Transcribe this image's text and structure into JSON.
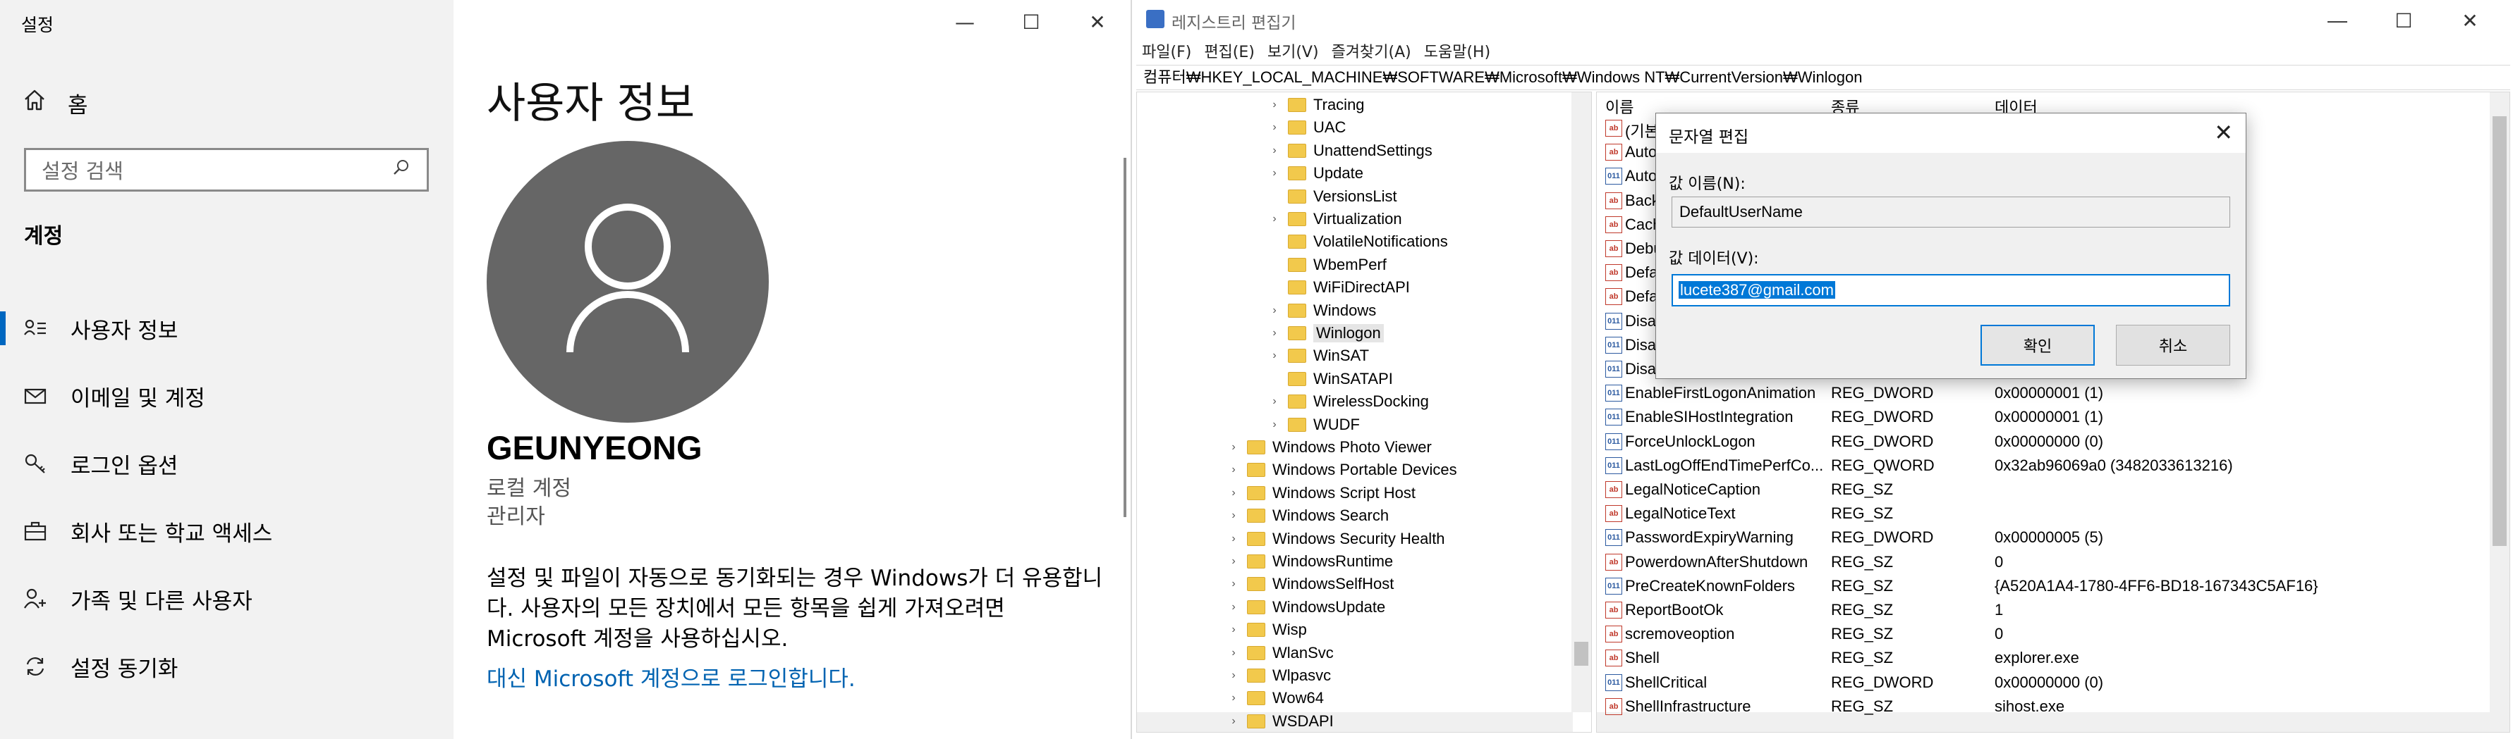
{
  "settings": {
    "window_title": "설정",
    "window_buttons": {
      "minimize": "—",
      "maximize": "☐",
      "close": "✕"
    },
    "home_label": "홈",
    "search_placeholder": "설정 검색",
    "section_title": "계정",
    "nav": [
      {
        "label": "사용자 정보",
        "icon": "user-info-icon"
      },
      {
        "label": "이메일 및 계정",
        "icon": "mail-icon"
      },
      {
        "label": "로그인 옵션",
        "icon": "key-icon"
      },
      {
        "label": "회사 또는 학교 액세스",
        "icon": "briefcase-icon"
      },
      {
        "label": "가족 및 다른 사용자",
        "icon": "add-person-icon"
      },
      {
        "label": "설정 동기화",
        "icon": "sync-icon"
      }
    ],
    "page_title": "사용자 정보",
    "user_name": "GEUNYEONG",
    "account_type": "로컬 계정",
    "role": "관리자",
    "description": "설정 및 파일이 자동으로 동기화되는 경우 Windows가 더 유용합니다. 사용자의 모든 장치에서 모든 항목을 쉽게 가져오려면 Microsoft 계정을 사용하십시오.",
    "link": "대신 Microsoft 계정으로 로그인합니다."
  },
  "regedit": {
    "window_title": "레지스트리 편집기",
    "window_buttons": {
      "minimize": "—",
      "maximize": "☐",
      "close": "✕"
    },
    "menu": [
      "파일(F)",
      "편집(E)",
      "보기(V)",
      "즐겨찾기(A)",
      "도움말(H)"
    ],
    "address": "컴퓨터₩HKEY_LOCAL_MACHINE₩SOFTWARE₩Microsoft₩Windows NT₩CurrentVersion₩Winlogon",
    "tree": [
      {
        "label": "Tracing",
        "level": 2,
        "expander": true
      },
      {
        "label": "UAC",
        "level": 2,
        "expander": true
      },
      {
        "label": "UnattendSettings",
        "level": 2,
        "expander": true
      },
      {
        "label": "Update",
        "level": 2,
        "expander": true
      },
      {
        "label": "VersionsList",
        "level": 2,
        "expander": false
      },
      {
        "label": "Virtualization",
        "level": 2,
        "expander": true
      },
      {
        "label": "VolatileNotifications",
        "level": 2,
        "expander": false
      },
      {
        "label": "WbemPerf",
        "level": 2,
        "expander": false
      },
      {
        "label": "WiFiDirectAPI",
        "level": 2,
        "expander": false
      },
      {
        "label": "Windows",
        "level": 2,
        "expander": true
      },
      {
        "label": "Winlogon",
        "level": 2,
        "expander": true,
        "selected": true
      },
      {
        "label": "WinSAT",
        "level": 2,
        "expander": true
      },
      {
        "label": "WinSATAPI",
        "level": 2,
        "expander": false
      },
      {
        "label": "WirelessDocking",
        "level": 2,
        "expander": true
      },
      {
        "label": "WUDF",
        "level": 2,
        "expander": true
      },
      {
        "label": "Windows Photo Viewer",
        "level": 1,
        "expander": true
      },
      {
        "label": "Windows Portable Devices",
        "level": 1,
        "expander": true
      },
      {
        "label": "Windows Script Host",
        "level": 1,
        "expander": true
      },
      {
        "label": "Windows Search",
        "level": 1,
        "expander": true
      },
      {
        "label": "Windows Security Health",
        "level": 1,
        "expander": true
      },
      {
        "label": "WindowsRuntime",
        "level": 1,
        "expander": true
      },
      {
        "label": "WindowsSelfHost",
        "level": 1,
        "expander": true
      },
      {
        "label": "WindowsUpdate",
        "level": 1,
        "expander": true
      },
      {
        "label": "Wisp",
        "level": 1,
        "expander": true
      },
      {
        "label": "WlanSvc",
        "level": 1,
        "expander": true
      },
      {
        "label": "Wlpasvc",
        "level": 1,
        "expander": true
      },
      {
        "label": "Wow64",
        "level": 1,
        "expander": true
      },
      {
        "label": "WSDAPI",
        "level": 1,
        "expander": true
      }
    ],
    "columns": {
      "name": "이름",
      "type": "종류",
      "data": "데이터"
    },
    "rows": [
      {
        "icon": "sz",
        "name": "(기본값)",
        "type": "",
        "data": ""
      },
      {
        "icon": "sz",
        "name": "AutoRestartShell",
        "type": "",
        "data": ""
      },
      {
        "icon": "bin",
        "name": "AutoAdminLogon",
        "type": "",
        "data": ""
      },
      {
        "icon": "sz",
        "name": "Background",
        "type": "",
        "data": ""
      },
      {
        "icon": "sz",
        "name": "CachedLogonsCount",
        "type": "",
        "data": ""
      },
      {
        "icon": "sz",
        "name": "DebugServerCommand",
        "type": "",
        "data": ""
      },
      {
        "icon": "sz",
        "name": "DefaultDomainName",
        "type": "",
        "data": ""
      },
      {
        "icon": "sz",
        "name": "DefaultUserName",
        "type": "",
        "data": ""
      },
      {
        "icon": "bin",
        "name": "DisableBackButton",
        "type": "",
        "data": ""
      },
      {
        "icon": "bin",
        "name": "DisableCAD",
        "type": "",
        "data": ""
      },
      {
        "icon": "bin",
        "name": "DisableLockWorkstation",
        "type": "",
        "data": ""
      },
      {
        "icon": "bin",
        "name": "EnableFirstLogonAnimation",
        "type": "REG_DWORD",
        "data": "0x00000001 (1)"
      },
      {
        "icon": "bin",
        "name": "EnableSIHostIntegration",
        "type": "REG_DWORD",
        "data": "0x00000001 (1)"
      },
      {
        "icon": "bin",
        "name": "ForceUnlockLogon",
        "type": "REG_DWORD",
        "data": "0x00000000 (0)"
      },
      {
        "icon": "bin",
        "name": "LastLogOffEndTimePerfCo...",
        "type": "REG_QWORD",
        "data": "0x32ab96069a0 (3482033613216)"
      },
      {
        "icon": "sz",
        "name": "LegalNoticeCaption",
        "type": "REG_SZ",
        "data": ""
      },
      {
        "icon": "sz",
        "name": "LegalNoticeText",
        "type": "REG_SZ",
        "data": ""
      },
      {
        "icon": "bin",
        "name": "PasswordExpiryWarning",
        "type": "REG_DWORD",
        "data": "0x00000005 (5)"
      },
      {
        "icon": "sz",
        "name": "PowerdownAfterShutdown",
        "type": "REG_SZ",
        "data": "0"
      },
      {
        "icon": "bin",
        "name": "PreCreateKnownFolders",
        "type": "REG_SZ",
        "data": "{A520A1A4-1780-4FF6-BD18-167343C5AF16}"
      },
      {
        "icon": "sz",
        "name": "ReportBootOk",
        "type": "REG_SZ",
        "data": "1"
      },
      {
        "icon": "sz",
        "name": "scremoveoption",
        "type": "REG_SZ",
        "data": "0"
      },
      {
        "icon": "sz",
        "name": "Shell",
        "type": "REG_SZ",
        "data": "explorer.exe"
      },
      {
        "icon": "bin",
        "name": "ShellCritical",
        "type": "REG_DWORD",
        "data": "0x00000000 (0)"
      },
      {
        "icon": "sz",
        "name": "ShellInfrastructure",
        "type": "REG_SZ",
        "data": "sihost.exe"
      }
    ],
    "dialog": {
      "title": "문자열 편집",
      "value_name_label": "값 이름(N):",
      "value_name": "DefaultUserName",
      "value_data_label": "값 데이터(V):",
      "value_data": "lucete387@gmail.com",
      "ok": "확인",
      "cancel": "취소"
    }
  },
  "colors": {
    "accent": "#0078d7",
    "settings_link": "#0063b1",
    "avatar": "#666666"
  }
}
